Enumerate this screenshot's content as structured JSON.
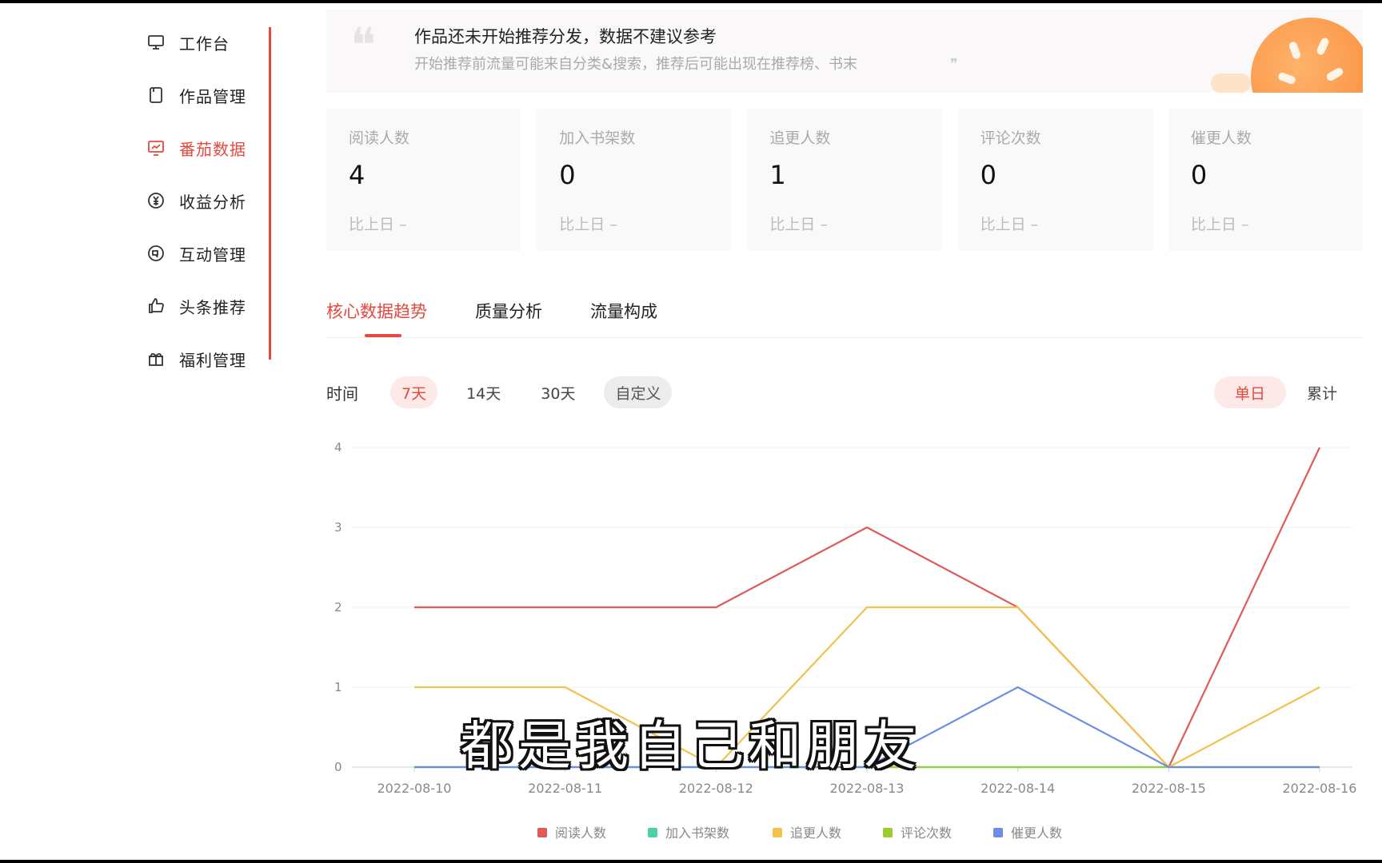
{
  "sidebar": {
    "items": [
      {
        "label": "工作台",
        "icon": "monitor-icon",
        "active": false
      },
      {
        "label": "作品管理",
        "icon": "book-icon",
        "active": false
      },
      {
        "label": "番茄数据",
        "icon": "chart-screen-icon",
        "active": true
      },
      {
        "label": "收益分析",
        "icon": "yuan-coin-icon",
        "active": false
      },
      {
        "label": "互动管理",
        "icon": "interaction-icon",
        "active": false
      },
      {
        "label": "头条推荐",
        "icon": "thumbs-up-icon",
        "active": false
      },
      {
        "label": "福利管理",
        "icon": "gift-icon",
        "active": false
      }
    ]
  },
  "notice": {
    "title": "作品还未开始推荐分发，数据不建议参考",
    "subtitle": "开始推荐前流量可能来自分类&搜索，推荐后可能出现在推荐榜、书末"
  },
  "stats": [
    {
      "label": "阅读人数",
      "value": "4",
      "compare": "比上日 –"
    },
    {
      "label": "加入书架数",
      "value": "0",
      "compare": "比上日 –"
    },
    {
      "label": "追更人数",
      "value": "1",
      "compare": "比上日 –"
    },
    {
      "label": "评论次数",
      "value": "0",
      "compare": "比上日 –"
    },
    {
      "label": "催更人数",
      "value": "0",
      "compare": "比上日 –"
    }
  ],
  "tabs": [
    {
      "label": "核心数据趋势",
      "active": true
    },
    {
      "label": "质量分析",
      "active": false
    },
    {
      "label": "流量构成",
      "active": false
    }
  ],
  "time_filter": {
    "label": "时间",
    "options": [
      {
        "label": "7天",
        "active": true
      },
      {
        "label": "14天",
        "active": false
      },
      {
        "label": "30天",
        "active": false
      },
      {
        "label": "自定义",
        "active": false,
        "custom": true
      }
    ]
  },
  "mode_options": [
    {
      "label": "单日",
      "active": true
    },
    {
      "label": "累计",
      "active": false
    }
  ],
  "subtitle_caption": "都是我自己和朋友",
  "colors": {
    "accent": "#e5483e"
  },
  "chart_data": {
    "type": "line",
    "x": [
      "2022-08-10",
      "2022-08-11",
      "2022-08-12",
      "2022-08-13",
      "2022-08-14",
      "2022-08-15",
      "2022-08-16"
    ],
    "ylim": [
      0,
      4
    ],
    "yticks": [
      0,
      1,
      2,
      3,
      4
    ],
    "legend_position": "bottom",
    "grid": true,
    "series": [
      {
        "name": "阅读人数",
        "color": "#e05a5a",
        "values": [
          2,
          2,
          2,
          3,
          2,
          0,
          4
        ]
      },
      {
        "name": "加入书架数",
        "color": "#4fd1a6",
        "values": [
          0,
          0,
          0,
          0,
          0,
          0,
          0
        ]
      },
      {
        "name": "追更人数",
        "color": "#f2c14e",
        "values": [
          1,
          1,
          0,
          2,
          2,
          0,
          1
        ]
      },
      {
        "name": "评论次数",
        "color": "#9acd32",
        "values": [
          0,
          0,
          0,
          0,
          0,
          0,
          0
        ]
      },
      {
        "name": "催更人数",
        "color": "#6b8fe5",
        "values": [
          0,
          0,
          0,
          0,
          1,
          0,
          0
        ]
      }
    ]
  }
}
